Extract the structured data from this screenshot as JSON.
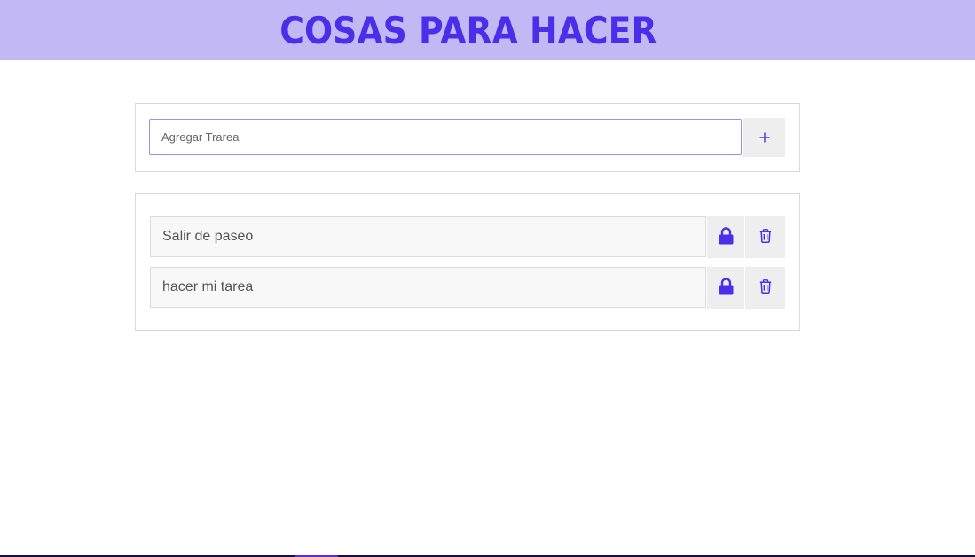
{
  "header": {
    "title": "COSAS PARA HACER"
  },
  "add_form": {
    "input_value": "",
    "input_placeholder": "Agregar Trarea",
    "add_icon": "plus-icon"
  },
  "tasks": [
    {
      "text": "Salir de paseo",
      "lock_icon": "lock-icon",
      "delete_icon": "trash-icon"
    },
    {
      "text": "hacer mi tarea",
      "lock_icon": "lock-icon",
      "delete_icon": "trash-icon"
    }
  ],
  "colors": {
    "accent": "#4b2eea",
    "header_bg": "#c2b9f4",
    "button_bg": "#eeeeee",
    "task_bg": "#f8f8f8"
  }
}
